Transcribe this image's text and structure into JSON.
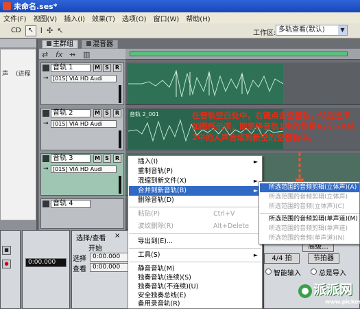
{
  "window": {
    "title": "未命名.ses*"
  },
  "menu": [
    "文件(F)",
    "视图(V)",
    "插入(I)",
    "效果(T)",
    "选项(O)",
    "窗口(W)",
    "帮助(H)"
  ],
  "toolbar": {
    "cd_label": "CD",
    "workspace_label": "工作区:",
    "workspace_value": "多轨查看(默认)"
  },
  "left_panel": {
    "lines": [
      "声",
      "(进程"
    ]
  },
  "tabs": {
    "main_group": "主群组",
    "mixer": "混音器"
  },
  "tracks": [
    {
      "name": "音轨 1",
      "device": "[01S] VIA HD Audi"
    },
    {
      "name": "音轨 2",
      "device": "[01S] VIA HD Audi"
    },
    {
      "name": "音轨 3",
      "device": "[01S] VIA HD Audi"
    },
    {
      "name": "音轨 4",
      "device": ""
    }
  ],
  "track_buttons": {
    "mute": "M",
    "solo": "S",
    "record": "R"
  },
  "clips": {
    "track2_label": "音轨 2_001"
  },
  "annotation": "在音轨空白处中，右键点击空音轨，然后选择如图所示项，即是将音轨1中的背景音乐与音轨2中的人声合成到新空的空音轨中。",
  "context_menu": {
    "items": [
      {
        "label": "插入(I)",
        "submenu": true,
        "disabled": false
      },
      {
        "label": "重制音轨(P)",
        "disabled": false
      },
      {
        "label": "混缩到新文件(X)",
        "submenu": true,
        "disabled": false
      },
      {
        "label": "合并到新音轨(B)",
        "submenu": true,
        "highlight": true,
        "disabled": false
      },
      {
        "label": "删除音轨(D)",
        "disabled": false
      },
      {
        "label": "粘贴(P)",
        "shortcut": "Ctrl+V",
        "disabled": true
      },
      {
        "label": "波纹删除(R)",
        "shortcut": "Alt+Delete",
        "disabled": true
      },
      {
        "label": "导出到(E)...",
        "disabled": false
      },
      {
        "label": "工具(S)",
        "submenu": true,
        "disabled": false
      },
      {
        "label": "静音音轨(M)",
        "disabled": false
      },
      {
        "label": "独奏音轨(连续)(S)",
        "disabled": false
      },
      {
        "label": "独奏音轨(不连续)(U)",
        "disabled": false
      },
      {
        "label": "安全独奏总线(E)",
        "disabled": false
      },
      {
        "label": "备用录音轨(R)",
        "disabled": false
      }
    ]
  },
  "submenu": {
    "items": [
      {
        "label": "所选范围的音频剪辑(立体声)(A)",
        "highlight": true,
        "disabled": false
      },
      {
        "label": "所选范围的音频剪辑(立体声)",
        "disabled": true
      },
      {
        "label": "所选范围的音频(立体声)(C)",
        "disabled": true
      },
      {
        "label": "所选范围的音频剪辑(单声道)(M)",
        "disabled": false
      },
      {
        "label": "所选范围的音频剪辑(单声道)",
        "disabled": true
      },
      {
        "label": "所选范围的音频(单声道)(N)",
        "disabled": true
      }
    ]
  },
  "selection_panel": {
    "tab": "选择/查看",
    "close": "×",
    "start_label": "开始",
    "select_label": "选择",
    "view_label": "查看",
    "select_start": "0:00.000",
    "view_start": "0:00.000",
    "time_display": "0:00.000"
  },
  "tempo_panel": {
    "time_sig": "4/4 拍",
    "advanced": "高级...",
    "metronome": "节拍器",
    "smart_input": "智能输入",
    "always_import": "总是导入"
  },
  "watermark": {
    "text": "派派网",
    "url": "www.pickee.com"
  }
}
